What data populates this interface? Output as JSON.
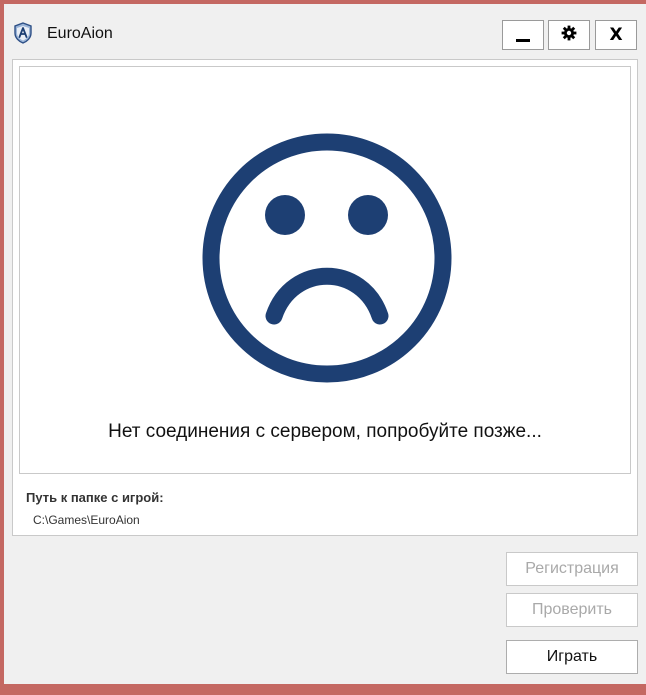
{
  "window": {
    "title": "EuroAion",
    "icon": "shield-a-icon",
    "controls": {
      "minimize_icon": "minimize-icon",
      "settings_icon": "gear-icon",
      "close_label": "X"
    }
  },
  "status": {
    "icon": "sad-face-icon",
    "message": "Нет соединения с сервером, попробуйте позже..."
  },
  "game_path": {
    "label": "Путь к папке с игрой:",
    "value": "C:\\Games\\EuroAion"
  },
  "actions": {
    "register_label": "Регистрация",
    "verify_label": "Проверить",
    "play_label": "Играть"
  },
  "colors": {
    "accent": "#1d3f73",
    "background": "#f0f0f0",
    "frame": "#c46862",
    "disabled_text": "#a9a9a9"
  }
}
